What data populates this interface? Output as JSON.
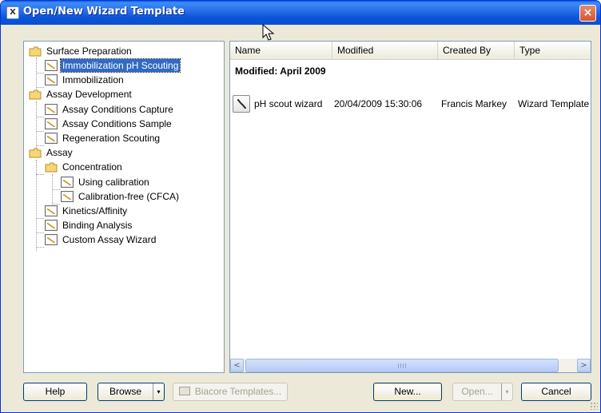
{
  "window": {
    "title": "Open/New Wizard Template",
    "icon_text": "X",
    "close_label": "×"
  },
  "tree": {
    "items": [
      {
        "label": "Surface Preparation",
        "kind": "folder"
      },
      {
        "label": "Immobilization pH Scouting",
        "kind": "wizard",
        "selected": true
      },
      {
        "label": "Immobilization",
        "kind": "wizard"
      },
      {
        "label": "Assay Development",
        "kind": "folder"
      },
      {
        "label": "Assay Conditions Capture",
        "kind": "wizard"
      },
      {
        "label": "Assay Conditions Sample",
        "kind": "wizard"
      },
      {
        "label": "Regeneration Scouting",
        "kind": "wizard"
      },
      {
        "label": "Assay",
        "kind": "folder"
      },
      {
        "label": "Concentration",
        "kind": "folder"
      },
      {
        "label": "Using calibration",
        "kind": "wizard"
      },
      {
        "label": "Calibration-free (CFCA)",
        "kind": "wizard"
      },
      {
        "label": "Kinetics/Affinity",
        "kind": "wizard"
      },
      {
        "label": "Binding Analysis",
        "kind": "wizard"
      },
      {
        "label": "Custom Assay Wizard",
        "kind": "wizard"
      }
    ]
  },
  "list": {
    "columns": [
      "Name",
      "Modified",
      "Created By",
      "Type"
    ],
    "group_header": "Modified: April 2009",
    "rows": [
      {
        "name": "pH scout wizard",
        "modified": "20/04/2009 15:30:06",
        "created_by": "Francis Markey",
        "type": "Wizard Template"
      }
    ]
  },
  "scroll": {
    "left_arrow": "<",
    "right_arrow": ">"
  },
  "buttons": {
    "help": "Help",
    "browse": "Browse",
    "browse_split": "▾",
    "biacore_templates": "Biacore Templates...",
    "new": "New...",
    "open": "Open...",
    "open_split": "▾",
    "cancel": "Cancel"
  },
  "icons": {
    "folder": "folder-icon",
    "wizard": "wizard-document-icon",
    "template": "template-icon",
    "cursor": "mouse-cursor-icon"
  },
  "colors": {
    "titlebar": "#0b55d9",
    "selection": "#316ac5",
    "dialog_bg": "#ece9d8",
    "close": "#d5552f"
  }
}
